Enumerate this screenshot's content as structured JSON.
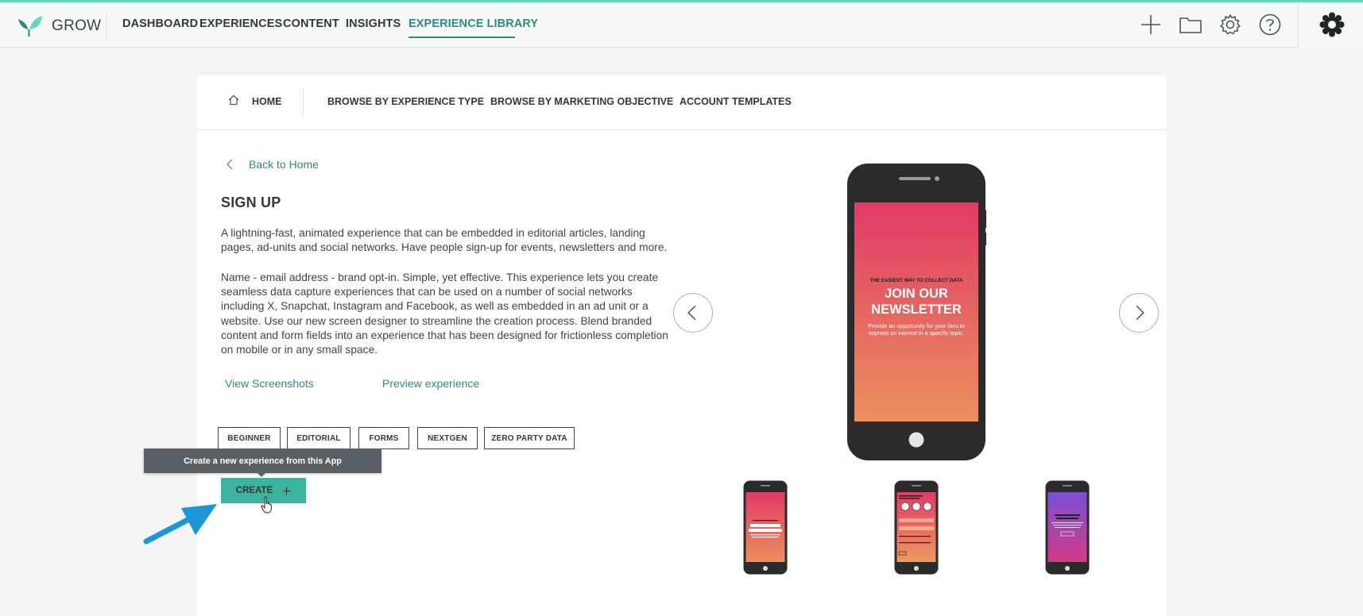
{
  "app": {
    "brand": "GROW",
    "accent_color": "#2e8a82",
    "button_color": "#3bb39d"
  },
  "topnav": {
    "items": [
      {
        "label": "DASHBOARD"
      },
      {
        "label": "EXPERIENCES"
      },
      {
        "label": "CONTENT"
      },
      {
        "label": "INSIGHTS"
      },
      {
        "label": "EXPERIENCE LIBRARY",
        "active": true
      }
    ],
    "icons": [
      "plus-icon",
      "folder-icon",
      "settings-icon",
      "help-icon",
      "gear-badge-icon"
    ]
  },
  "subnav": {
    "home": "HOME",
    "items": [
      {
        "label": "BROWSE BY EXPERIENCE TYPE"
      },
      {
        "label": "BROWSE BY MARKETING OBJECTIVE"
      },
      {
        "label": "ACCOUNT TEMPLATES"
      }
    ]
  },
  "detail": {
    "back_label": "Back to Home",
    "title": "SIGN UP",
    "description_1": "A lightning-fast, animated experience that can be embedded in editorial articles, landing pages, ad-units and social networks. Have people sign-up for events, newsletters and more.",
    "description_2": "Name - email address - brand opt-in. Simple, yet effective. This experience lets you create seamless data capture experiences that can be used on a number of social networks including X, Snapchat, Instagram and Facebook, as well as embedded in an ad unit or a website. Use our new screen designer to streamline the creation process. Blend branded content and form fields into an experience that has been designed for frictionless completion on mobile or in any small space.",
    "view_screenshots": "View Screenshots",
    "preview": "Preview experience",
    "tags": [
      "BEGINNER",
      "EDITORIAL",
      "FORMS",
      "NEXTGEN",
      "ZERO PARTY DATA"
    ],
    "tooltip": "Create a new experience from this App",
    "create_label": "CREATE"
  },
  "preview": {
    "main_screen": {
      "kicker": "THE EASIEST WAY TO COLLECT DATA",
      "headline_1": "JOIN OUR",
      "headline_2": "NEWSLETTER",
      "body_1": "Provide an opportunity for your fans to",
      "body_2": "express an interest in a specific topic."
    },
    "thumbnails": [
      "newsletter-screen",
      "form-screen",
      "thank-you-screen"
    ]
  }
}
